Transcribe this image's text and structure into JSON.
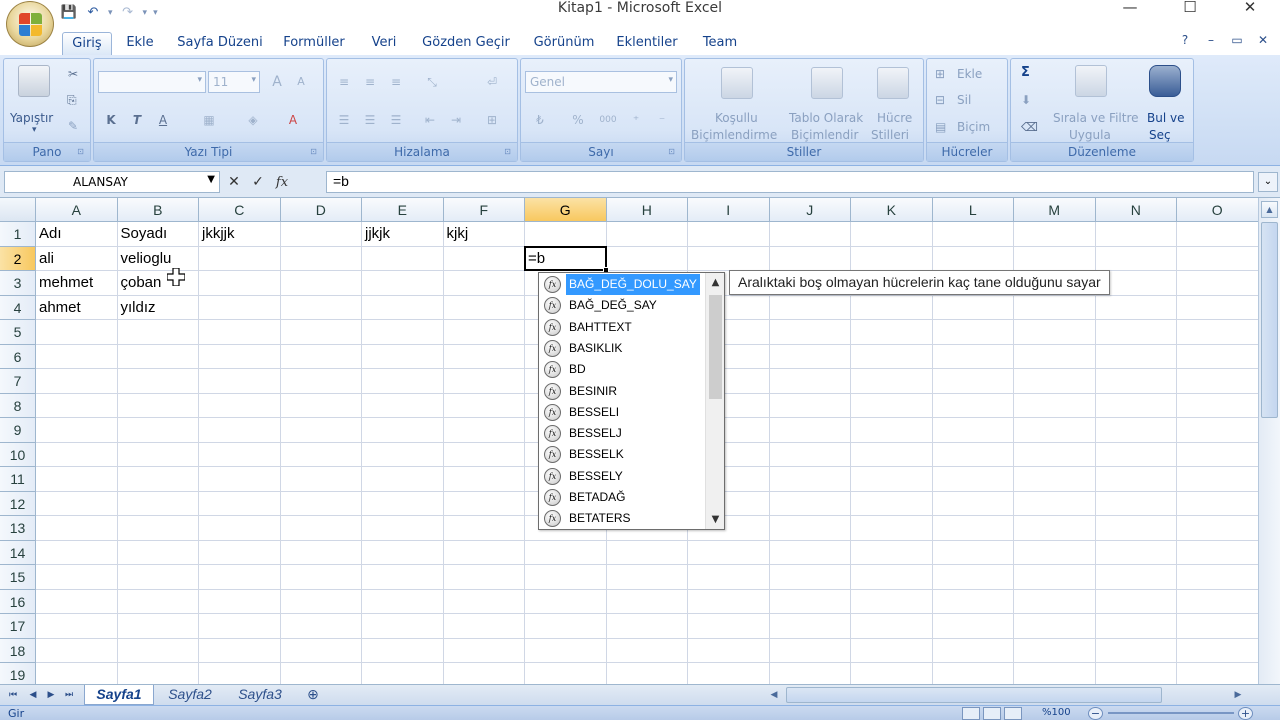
{
  "window": {
    "title": "Kitap1 - Microsoft Excel",
    "controls": [
      "—",
      "☐",
      "✕"
    ]
  },
  "qat": [
    "💾",
    "↶",
    "▾",
    "↷",
    "▾",
    "▾"
  ],
  "ribbon_tabs": [
    "Giriş",
    "Ekle",
    "Sayfa Düzeni",
    "Formüller",
    "Veri",
    "Gözden Geçir",
    "Görünüm",
    "Eklentiler",
    "Team"
  ],
  "ribbon_right": [
    "?",
    "–",
    "▭",
    "✕"
  ],
  "ribbon": {
    "pano": {
      "label": "Pano",
      "paste": "Yapıştır"
    },
    "yazi_tipi": {
      "label": "Yazı Tipi",
      "size": "11",
      "bold": "K",
      "italic": "T",
      "underline": "A",
      "grow": "A",
      "shrink": "A"
    },
    "hizalama": {
      "label": "Hizalama"
    },
    "sayi": {
      "label": "Sayı",
      "format": "Genel",
      "percent": "%",
      "thousands": "000"
    },
    "stiller": {
      "label": "Stiller",
      "cond_line1": "Koşullu",
      "cond_line2": "Biçimlendirme",
      "table_line1": "Tablo Olarak",
      "table_line2": "Biçimlendir",
      "cell_line1": "Hücre",
      "cell_line2": "Stilleri"
    },
    "hucreler": {
      "label": "Hücreler",
      "insert": "Ekle",
      "delete": "Sil",
      "format": "Biçim"
    },
    "duzenleme": {
      "label": "Düzenleme",
      "sigma": "Σ",
      "sort_line1": "Sırala ve Filtre",
      "sort_line2": "Uygula",
      "find_line1": "Bul ve",
      "find_line2": "Seç"
    }
  },
  "formula_bar": {
    "name_box": "ALANSAY",
    "fx": "fx",
    "cancel": "✕",
    "enter": "✓",
    "formula": "=b"
  },
  "sheet": {
    "columns": [
      "A",
      "B",
      "C",
      "D",
      "E",
      "F",
      "G",
      "H",
      "I",
      "J",
      "K",
      "L",
      "M",
      "N",
      "O"
    ],
    "rows": [
      "1",
      "2",
      "3",
      "4",
      "5",
      "6",
      "7",
      "8",
      "9",
      "10",
      "11",
      "12",
      "13",
      "14",
      "15",
      "16",
      "17",
      "18",
      "19"
    ],
    "selected_column": "G",
    "selected_row": "2",
    "active_cell_text": "=b",
    "cells": {
      "A1": "Adı",
      "B1": "Soyadı",
      "C1": "jkkjjk",
      "E1": "jjkjk",
      "F1": "kjkj",
      "A2": "ali",
      "B2": "velioglu",
      "A3": "mehmet",
      "B3": "çoban",
      "A4": "ahmet",
      "B4": "yıldız"
    }
  },
  "autocomplete": {
    "items": [
      "BAĞ_DEĞ_DOLU_SAY",
      "BAĞ_DEĞ_SAY",
      "BAHTTEXT",
      "BASIKLIK",
      "BD",
      "BESINIR",
      "BESSELI",
      "BESSELJ",
      "BESSELK",
      "BESSELY",
      "BETADAĞ",
      "BETATERS"
    ],
    "selected_index": 0,
    "icon_text": "fx",
    "tooltip": "Aralıktaki boş olmayan hücrelerin kaç tane olduğunu sayar"
  },
  "sheet_tabs": [
    "Sayfa1",
    "Sayfa2",
    "Sayfa3"
  ],
  "active_sheet": "Sayfa1",
  "status": {
    "mode": "Gir",
    "zoom": "%100",
    "zoom_minus": "−",
    "zoom_plus": "+"
  }
}
